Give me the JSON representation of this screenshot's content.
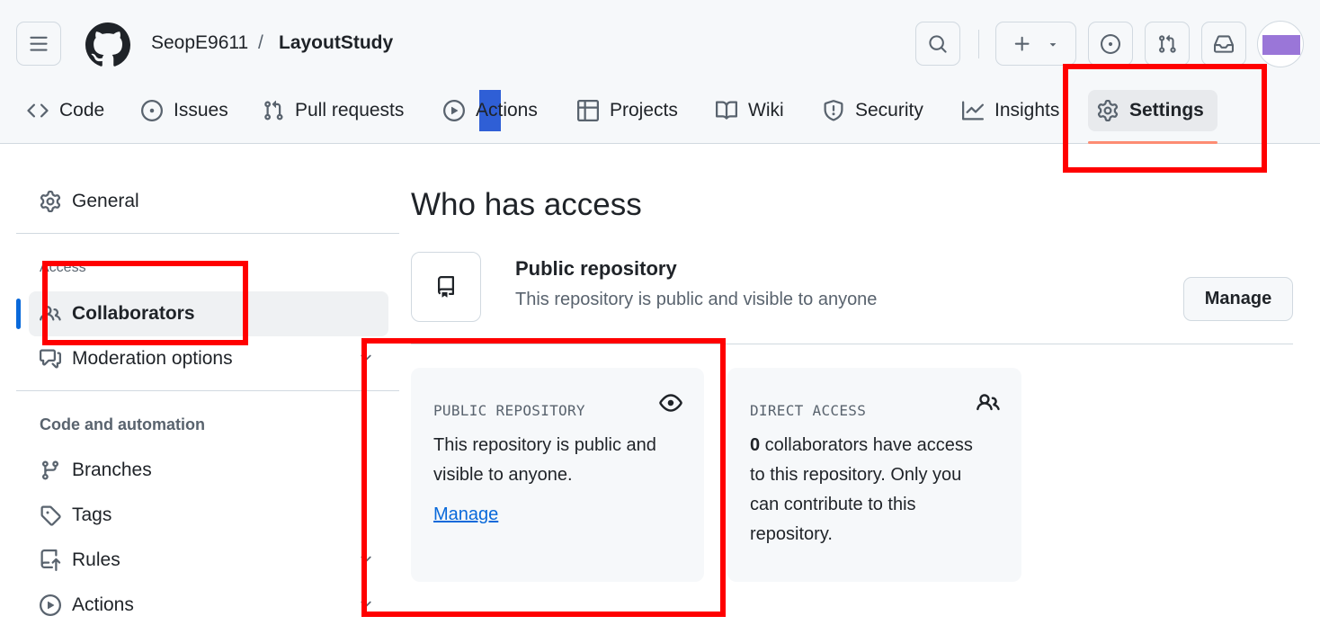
{
  "header": {
    "owner": "SeopE9611",
    "separator": "/",
    "repo_name": "LayoutStudy",
    "buttons": [
      "menu-icon",
      "search-icon",
      "plus-icon",
      "issue-icon",
      "pull-request-icon",
      "inbox-icon"
    ],
    "avatar_color": "#9a76d8"
  },
  "nav": {
    "tabs": [
      {
        "label": "Code",
        "icon": "code-icon"
      },
      {
        "label": "Issues",
        "icon": "issue-icon"
      },
      {
        "label": "Pull requests",
        "icon": "pull-request-icon"
      },
      {
        "label": "Actions",
        "icon": "play-icon"
      },
      {
        "label": "Projects",
        "icon": "table-icon"
      },
      {
        "label": "Wiki",
        "icon": "book-icon"
      },
      {
        "label": "Security",
        "icon": "shield-icon"
      },
      {
        "label": "Insights",
        "icon": "graph-icon"
      },
      {
        "label": "Settings",
        "icon": "gear-icon",
        "active": true
      }
    ]
  },
  "sidebar": {
    "general": "General",
    "access_heading": "Access",
    "collaborators": "Collaborators",
    "moderation": "Moderation options",
    "code_heading": "Code and automation",
    "branches": "Branches",
    "tags": "Tags",
    "rules": "Rules",
    "actions": "Actions"
  },
  "main": {
    "title": "Who has access",
    "visibility_title": "Public repository",
    "visibility_desc": "This repository is public and visible to anyone",
    "manage_button": "Manage",
    "cards": {
      "public": {
        "label": "PUBLIC REPOSITORY",
        "text_line1": "This repository is public and",
        "text_line2": "visible to anyone.",
        "link": "Manage"
      },
      "direct": {
        "label": "DIRECT ACCESS",
        "count": "0",
        "text_line1": " collaborators have access",
        "text_line2": "to this repository. Only you",
        "text_line3": "can contribute to this",
        "text_line4": "repository."
      }
    }
  },
  "colors": {
    "accent_blue": "#0969da",
    "tab_underline": "#fd8c73",
    "highlight_red": "#ff0000"
  }
}
